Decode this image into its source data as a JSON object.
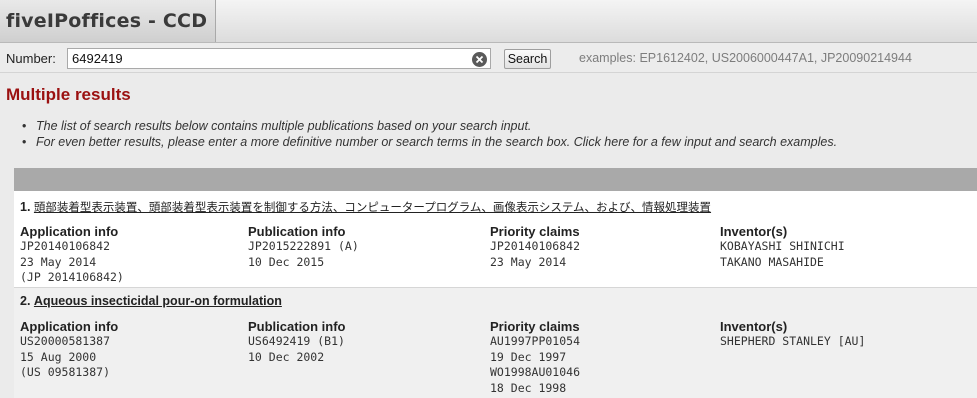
{
  "app": {
    "title": "fiveIPoffices - CCD"
  },
  "search": {
    "label": "Number:",
    "value": "6492419",
    "button": "Search",
    "examples": "examples: EP1612402, US2006000447A1, JP20090214944"
  },
  "heading": "Multiple results",
  "notes": [
    "The list of search results below contains multiple publications based on your search input.",
    "For even better results, please enter a more definitive number or search terms in the search box. Click here for a few input and search examples."
  ],
  "columns": {
    "application": "Application info",
    "publication": "Publication info",
    "priority": "Priority claims",
    "inventors": "Inventor(s)"
  },
  "results": [
    {
      "num": "1.",
      "title": "頭部装着型表示装置、頭部装着型表示装置を制御する方法、コンピュータープログラム、画像表示システム、および、情報処理装置",
      "application": [
        "JP20140106842",
        "23 May 2014",
        "(JP 2014106842)"
      ],
      "publication": [
        "JP2015222891 (A)",
        "10 Dec 2015"
      ],
      "priority": [
        "JP20140106842",
        "23 May 2014"
      ],
      "inventors": [
        "KOBAYASHI SHINICHI",
        "TAKANO MASAHIDE"
      ]
    },
    {
      "num": "2.",
      "title": "Aqueous insecticidal pour-on formulation",
      "application": [
        "US20000581387",
        "15 Aug 2000",
        "(US 09581387)"
      ],
      "publication": [
        "US6492419 (B1)",
        "10 Dec 2002"
      ],
      "priority": [
        "AU1997PP01054",
        "19 Dec 1997",
        "WO1998AU01046",
        "18 Dec 1998"
      ],
      "inventors": [
        "SHEPHERD STANLEY [AU]"
      ]
    }
  ]
}
